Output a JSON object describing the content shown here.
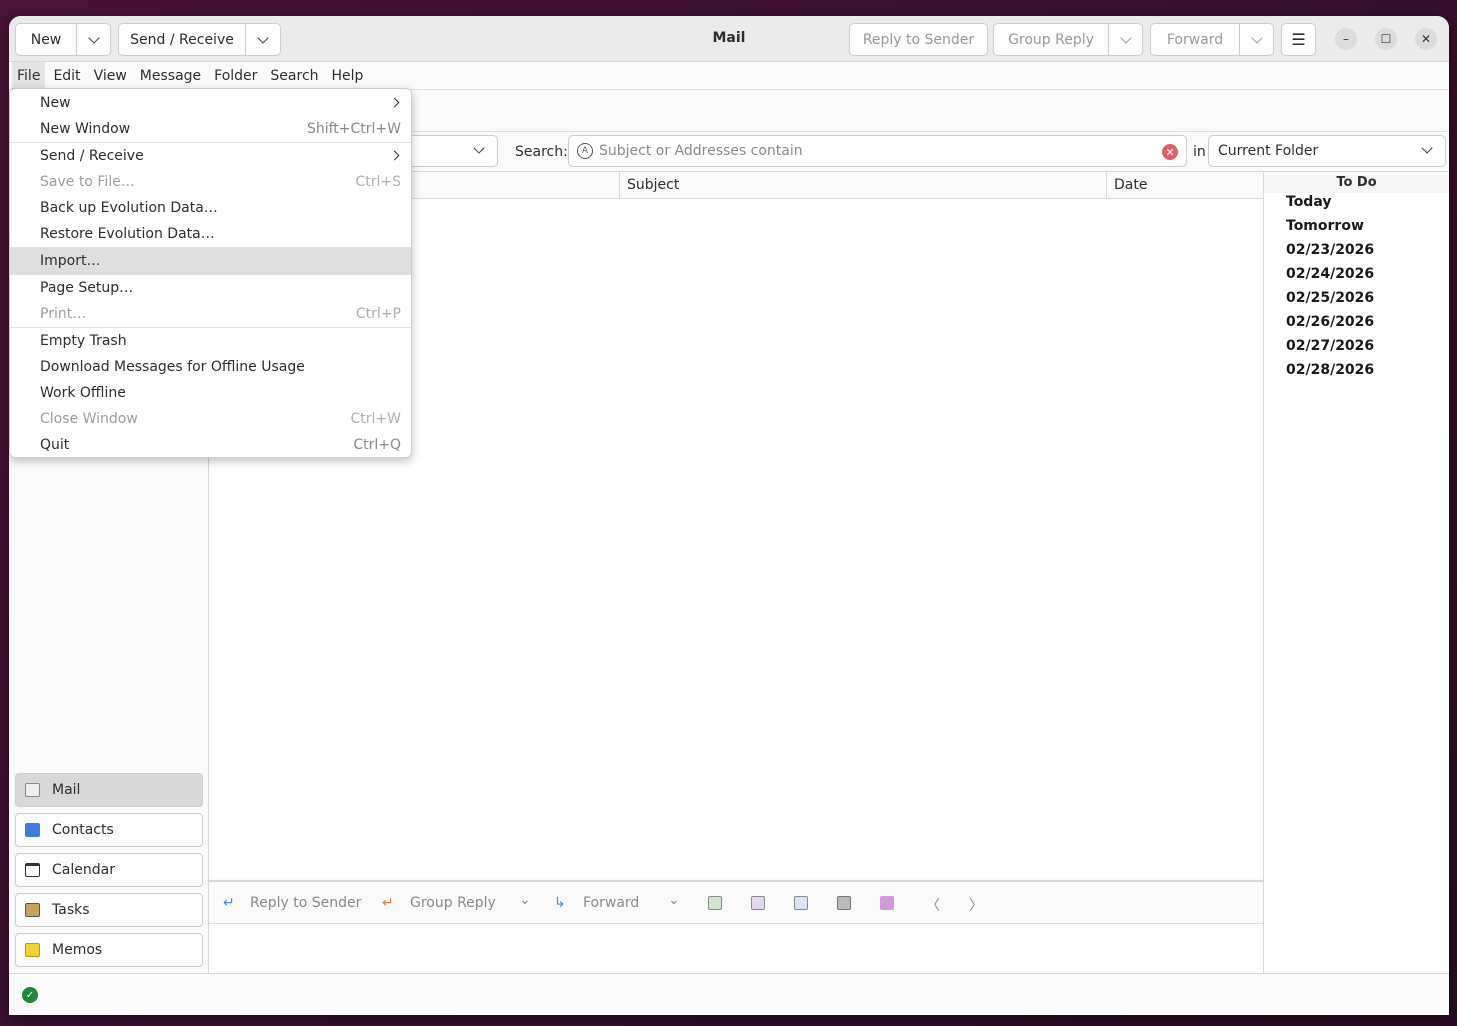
{
  "window": {
    "title": "Mail"
  },
  "header": {
    "new_label": "New",
    "send_receive_label": "Send / Receive",
    "reply_sender_label": "Reply to Sender",
    "group_reply_label": "Group Reply",
    "forward_label": "Forward"
  },
  "menubar": [
    "File",
    "Edit",
    "View",
    "Message",
    "Folder",
    "Search",
    "Help"
  ],
  "file_menu": [
    {
      "label": "New",
      "shortcut": "",
      "submenu": true,
      "disabled": false
    },
    {
      "label": "New Window",
      "shortcut": "Shift+Ctrl+W",
      "submenu": false,
      "disabled": false
    },
    {
      "label": "Send / Receive",
      "shortcut": "",
      "submenu": true,
      "disabled": false
    },
    {
      "label": "Save to File…",
      "shortcut": "Ctrl+S",
      "submenu": false,
      "disabled": true
    },
    {
      "label": "Back up Evolution Data…",
      "shortcut": "",
      "submenu": false,
      "disabled": false
    },
    {
      "label": "Restore Evolution Data…",
      "shortcut": "",
      "submenu": false,
      "disabled": false
    },
    {
      "label": "Import…",
      "shortcut": "",
      "submenu": false,
      "disabled": false,
      "hover": true
    },
    {
      "label": "Page Setup…",
      "shortcut": "",
      "submenu": false,
      "disabled": false
    },
    {
      "label": "Print…",
      "shortcut": "Ctrl+P",
      "submenu": false,
      "disabled": true
    },
    {
      "label": "Empty Trash",
      "shortcut": "",
      "submenu": false,
      "disabled": false
    },
    {
      "label": "Download Messages for Offline Usage",
      "shortcut": "",
      "submenu": false,
      "disabled": false
    },
    {
      "label": "Work Offline",
      "shortcut": "",
      "submenu": false,
      "disabled": false
    },
    {
      "label": "Close Window",
      "shortcut": "Ctrl+W",
      "submenu": false,
      "disabled": true
    },
    {
      "label": "Quit",
      "shortcut": "Ctrl+Q",
      "submenu": false,
      "disabled": false
    }
  ],
  "search": {
    "label": "Search:",
    "placeholder": "Subject or Addresses contain",
    "in_label": "in",
    "scope": "Current Folder"
  },
  "list_columns": {
    "subject": "Subject",
    "date": "Date"
  },
  "todo": {
    "title": "To Do",
    "items": [
      "Today",
      "Tomorrow",
      "02/23/2026",
      "02/24/2026",
      "02/25/2026",
      "02/26/2026",
      "02/27/2026",
      "02/28/2026"
    ]
  },
  "switcher": [
    "Mail",
    "Contacts",
    "Calendar",
    "Tasks",
    "Memos"
  ],
  "preview_toolbar": {
    "reply_sender": "Reply to Sender",
    "group_reply": "Group Reply",
    "forward": "Forward"
  },
  "colors": {
    "accent": "#e95420",
    "status_ok": "#1d8a3a"
  }
}
